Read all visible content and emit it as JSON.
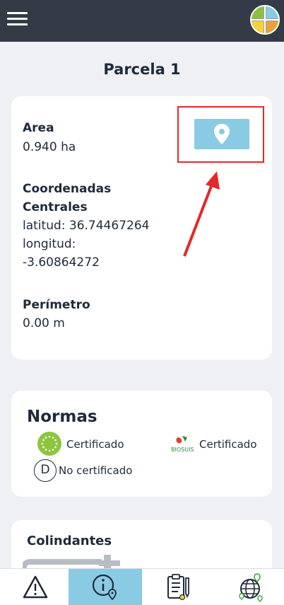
{
  "header": {
    "menu_icon": "hamburger-menu-icon",
    "logo_icon": "app-logo-globe-icon"
  },
  "page": {
    "title": "Parcela 1"
  },
  "parcel": {
    "area_label": "Area",
    "area_value": "0.940 ha",
    "coords_label_line1": "Coordenadas",
    "coords_label_line2": "Centrales",
    "latitude": "latitud: 36.74467264",
    "longitude_label": "longitud:",
    "longitude_value": "-3.60864272",
    "perimeter_label": "Perímetro",
    "perimeter_value": "0.00 m",
    "map_button_icon": "map-pin-icon"
  },
  "normas": {
    "title": "Normas",
    "items": [
      {
        "icon": "eu-organic-leaf-icon",
        "status": "Certificado"
      },
      {
        "icon": "biosuisse-logo-icon",
        "status": "Certificado"
      },
      {
        "icon": "demeter-d-icon",
        "badge": "D",
        "status": "No certificado"
      }
    ]
  },
  "colindantes": {
    "title": "Colindantes"
  },
  "bottom_nav": {
    "items": [
      {
        "icon": "warning-triangle-icon",
        "active": false
      },
      {
        "icon": "info-location-icon",
        "active": true
      },
      {
        "icon": "clipboard-checklist-icon",
        "active": false
      },
      {
        "icon": "globe-location-icon",
        "active": false
      }
    ]
  },
  "colors": {
    "topbar": "#343b46",
    "accent": "#89cbe3",
    "highlight": "#e5282a",
    "background": "#eef0f3"
  }
}
